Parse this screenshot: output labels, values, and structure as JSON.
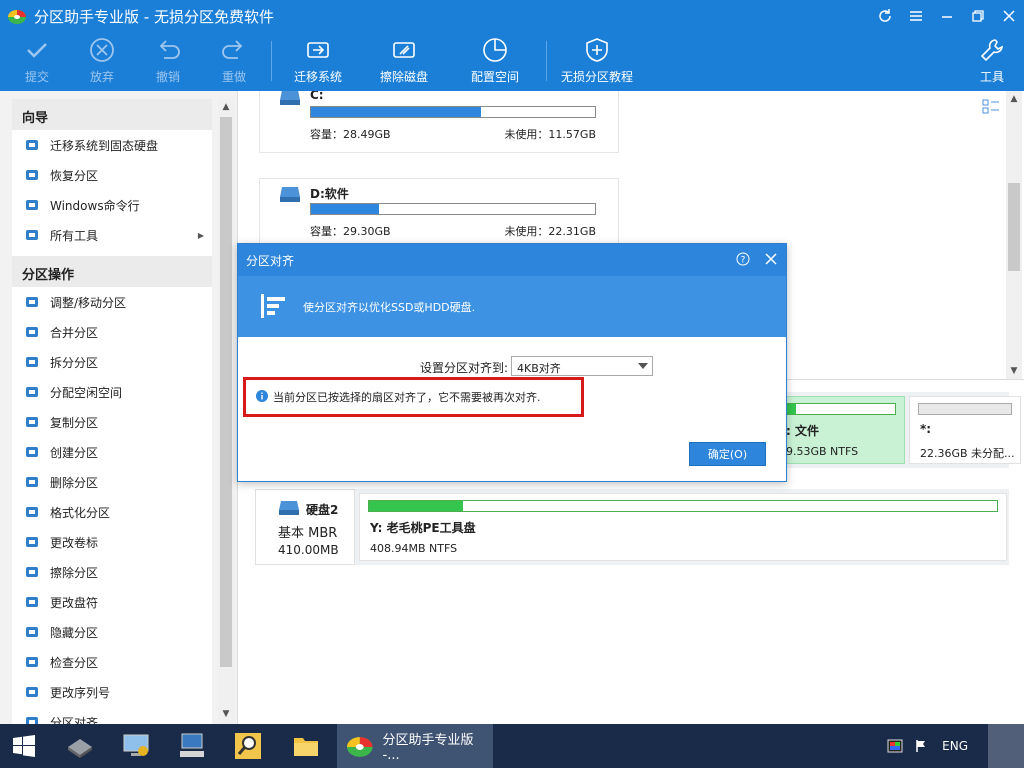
{
  "window": {
    "title": "分区助手专业版 - 无损分区免费软件",
    "controls": [
      "refresh-icon",
      "menu-icon",
      "minimize-icon",
      "maximize-icon",
      "close-icon"
    ]
  },
  "toolbar": {
    "commit": "提交",
    "discard": "放弃",
    "undo": "撤销",
    "redo": "重做",
    "migrate": "迁移系统",
    "wipe": "擦除磁盘",
    "allocate": "配置空间",
    "tutorial": "无损分区教程",
    "tools": "工具"
  },
  "sidebar": {
    "wizard_header": "向导",
    "wizard_items": [
      {
        "label": "迁移系统到固态硬盘",
        "icon": "migrate-icon"
      },
      {
        "label": "恢复分区",
        "icon": "recover-icon"
      },
      {
        "label": "Windows命令行",
        "icon": "windows-icon"
      },
      {
        "label": "所有工具",
        "icon": "tools-grid-icon"
      }
    ],
    "ops_header": "分区操作",
    "ops_items": [
      {
        "label": "调整/移动分区",
        "icon": "resize-icon"
      },
      {
        "label": "合并分区",
        "icon": "merge-icon"
      },
      {
        "label": "拆分分区",
        "icon": "split-icon"
      },
      {
        "label": "分配空闲空间",
        "icon": "allocate-icon"
      },
      {
        "label": "复制分区",
        "icon": "copy-icon"
      },
      {
        "label": "创建分区",
        "icon": "create-icon"
      },
      {
        "label": "删除分区",
        "icon": "delete-icon"
      },
      {
        "label": "格式化分区",
        "icon": "format-icon"
      },
      {
        "label": "更改卷标",
        "icon": "label-icon"
      },
      {
        "label": "擦除分区",
        "icon": "wipe-icon"
      },
      {
        "label": "更改盘符",
        "icon": "letter-icon"
      },
      {
        "label": "隐藏分区",
        "icon": "hide-icon"
      },
      {
        "label": "检查分区",
        "icon": "check-icon"
      },
      {
        "label": "更改序列号",
        "icon": "serial-icon"
      },
      {
        "label": "分区对齐",
        "icon": "align-icon"
      }
    ]
  },
  "partitions": [
    {
      "name": "C:",
      "used_ratio": 0.6,
      "capacity": "容量：28.49GB",
      "free": "未使用：11.57GB"
    },
    {
      "name": "D:软件",
      "used_ratio": 0.24,
      "capacity": "容量：29.30GB",
      "free": "未使用：22.31GB"
    }
  ],
  "disk1_segments": [
    {
      "name": ": 文件",
      "detail": "9.53GB NTFS",
      "used_ratio": 0.1
    },
    {
      "name": "*:",
      "detail": "22.36GB 未分配...",
      "used_ratio": 0
    }
  ],
  "disk2": {
    "name": "硬盘2",
    "type": "基本 MBR",
    "size": "410.00MB",
    "partition_name": "Y: 老毛桃PE工具盘",
    "partition_detail": "408.94MB NTFS",
    "used_ratio": 0.15
  },
  "dialog": {
    "title": "分区对齐",
    "banner": "使分区对齐以优化SSD或HDD硬盘.",
    "field_label": "设置分区对齐到:",
    "select_value": "4KB对齐",
    "notice": "当前分区已按选择的扇区对齐了，它不需要被再次对齐.",
    "ok": "确定(O)"
  },
  "taskbar": {
    "task_label": "分区助手专业版 -...",
    "ime": "ENG"
  },
  "colors": {
    "brand": "#1b7fd8",
    "notice_border": "#d81919",
    "partition_bar": "#2f86de",
    "disk_bar": "#35c44e"
  }
}
